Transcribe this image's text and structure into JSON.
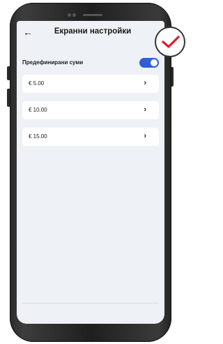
{
  "header": {
    "back_icon": "arrow-left-icon",
    "title": "Екранни настройки"
  },
  "setting": {
    "label": "Предефинирани суми",
    "enabled": true,
    "toggle_color": "#2f5fd3"
  },
  "amounts": [
    "€ 5.00",
    "€ 10.00",
    "€ 15.00"
  ],
  "badge": {
    "icon": "check-icon",
    "color": "#e1192b"
  }
}
